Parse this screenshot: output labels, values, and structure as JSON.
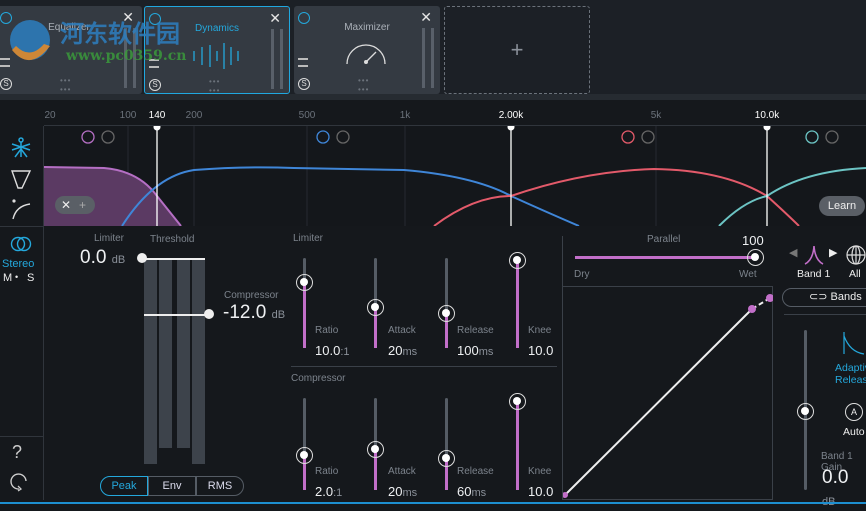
{
  "modules": [
    {
      "name": "Equalizer",
      "selected": false
    },
    {
      "name": "Dynamics",
      "selected": true
    },
    {
      "name": "Maximizer",
      "selected": false
    }
  ],
  "add_module": "+",
  "close": "✕",
  "solo": "S",
  "watermark": {
    "title": "河东软件园",
    "url": "www.pc0359.cn"
  },
  "ruler": {
    "ticks": [
      "20",
      "100",
      "200",
      "500",
      "1k",
      "5k"
    ],
    "crossovers": [
      "140",
      "2.00k",
      "10.0k"
    ]
  },
  "bands": {
    "colors": [
      "#b56fc4",
      "#3f86d8",
      "#e35a6a",
      "#6cc4c4"
    ]
  },
  "spectrum": {
    "learn": "Learn",
    "remove": "✕",
    "add": "+"
  },
  "sidebar": {
    "stereo": "Stereo",
    "m": "M",
    "dot": "•",
    "s": "S",
    "help": "?"
  },
  "threshold": {
    "title": "Threshold",
    "limiter_label": "Limiter",
    "limiter_value": "0.0",
    "limiter_unit": "dB",
    "compressor_label": "Compressor",
    "compressor_value": "-12.0",
    "compressor_unit": "dB"
  },
  "detection": {
    "options": [
      "Peak",
      "Env",
      "RMS"
    ],
    "selected": "Peak"
  },
  "limiter": {
    "title": "Limiter",
    "controls": [
      {
        "label": "Ratio",
        "value": "10.0",
        "unit": ":1",
        "level": 0.73
      },
      {
        "label": "Attack",
        "value": "20",
        "unit": "ms",
        "level": 0.46
      },
      {
        "label": "Release",
        "value": "100",
        "unit": "ms",
        "level": 0.39
      },
      {
        "label": "Knee",
        "value": "10.0",
        "unit": "",
        "level": 0.98
      }
    ]
  },
  "compressor": {
    "title": "Compressor",
    "controls": [
      {
        "label": "Ratio",
        "value": "2.0",
        "unit": ":1",
        "level": 0.38
      },
      {
        "label": "Attack",
        "value": "20",
        "unit": "ms",
        "level": 0.45
      },
      {
        "label": "Release",
        "value": "60",
        "unit": "ms",
        "level": 0.35
      },
      {
        "label": "Knee",
        "value": "10.0",
        "unit": "",
        "level": 0.97
      }
    ]
  },
  "parallel": {
    "label": "Parallel",
    "value": "100",
    "dry": "Dry",
    "wet": "Wet",
    "level": 1.0
  },
  "band_panel": {
    "band": "Band 1",
    "all": "All",
    "bands_link": "Bands",
    "adaptive": "Adaptive Release",
    "auto_icon": "A",
    "auto": "Auto",
    "gain_label": "Band 1 Gain",
    "gain_value": "0.0",
    "gain_unit": "dB"
  },
  "accent": "#20a8e0"
}
